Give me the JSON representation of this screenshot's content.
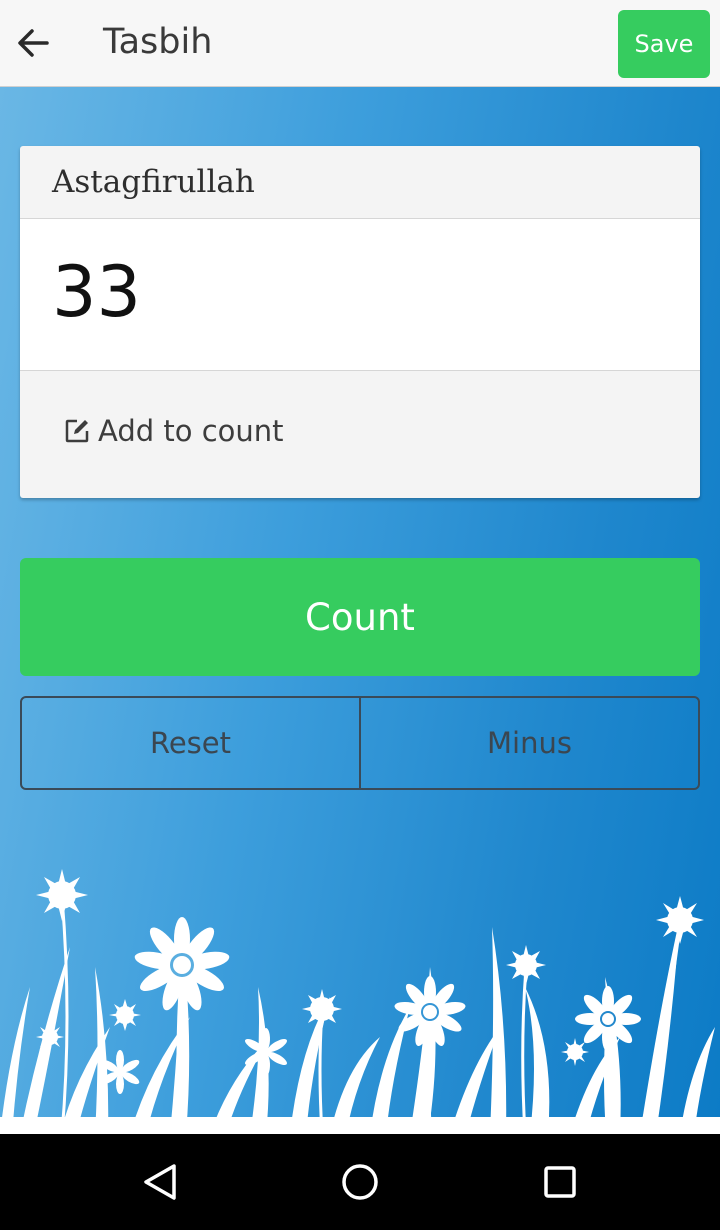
{
  "header": {
    "title": "Tasbih",
    "back_icon": "arrow-left-icon",
    "save_label": "Save",
    "save_color": "#36cc5f"
  },
  "card": {
    "title": "Astagfirullah",
    "count": "33",
    "add_label": "Add to count",
    "add_icon": "edit-icon"
  },
  "buttons": {
    "count_label": "Count",
    "reset_label": "Reset",
    "minus_label": "Minus",
    "accent_color": "#36cc5f"
  },
  "navbar": {
    "icons": [
      "back-triangle-icon",
      "home-circle-icon",
      "recents-square-icon"
    ]
  }
}
